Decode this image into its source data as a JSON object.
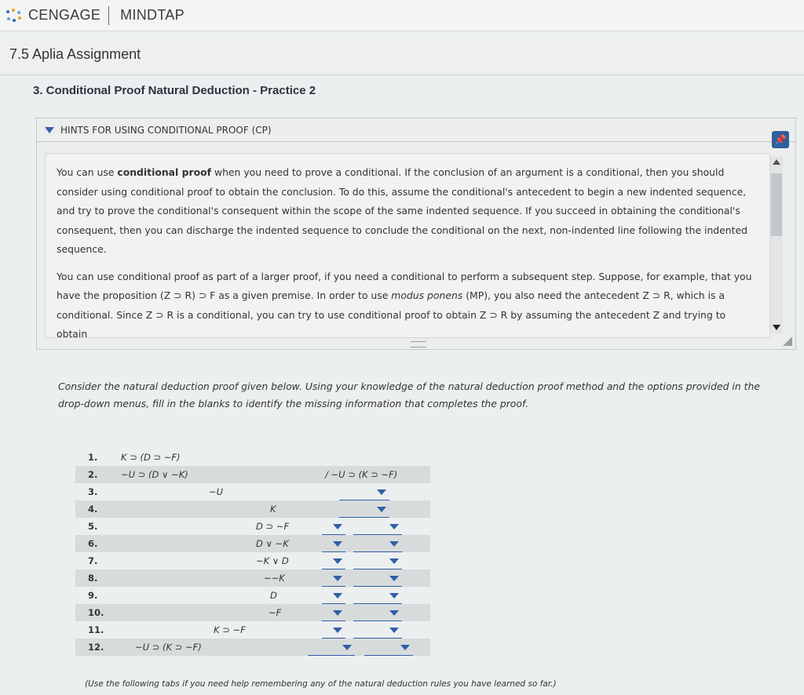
{
  "brand": {
    "name": "CENGAGE",
    "product": "MINDTAP",
    "dot_colors": [
      "#2f6db5",
      "#f0a21e",
      "#5aa9d6"
    ]
  },
  "assignment": {
    "title": "7.5 Aplia Assignment"
  },
  "question": {
    "title": "3. Conditional Proof Natural Deduction - Practice 2"
  },
  "hints": {
    "header": "HINTS FOR USING CONDITIONAL PROOF (CP)",
    "p1_a": "You can use ",
    "p1_bold": "conditional proof",
    "p1_b": " when you need to prove a conditional. If the conclusion of an argument is a conditional, then you should consider using conditional proof to obtain the conclusion. To do this, assume the conditional's antecedent to begin a new indented sequence, and try to prove the conditional's consequent within the scope of the same indented sequence. If you succeed in obtaining the conditional's consequent, then you can discharge the indented sequence to conclude the conditional on the next, non-indented line following the indented sequence.",
    "p2_a": "You can use conditional proof as part of a larger proof, if you need a conditional to perform a subsequent step. Suppose, for example, that you have the proposition (Z ⊃ R) ⊃ F as a given premise. In order to use ",
    "p2_italic": "modus ponens",
    "p2_b": " (MP), you also need the antecedent Z ⊃ R, which is a conditional. Since Z ⊃ R is a conditional, you can try to use conditional proof to obtain Z ⊃ R by assuming the antecedent Z and trying to obtain"
  },
  "instructions": "Consider the natural deduction proof given below. Using your knowledge of the natural deduction proof method and the options provided in the drop-down menus, fill in the blanks to identify the missing information that completes the proof.",
  "proof": {
    "conclusion": "/ ~U ⊃ (K ⊃ ~F)",
    "lines": [
      {
        "num": "1.",
        "formula": "K ⊃ (D ⊃ ~F)"
      },
      {
        "num": "2.",
        "formula": "~U ⊃ (D ∨ ~K)"
      },
      {
        "num": "3.",
        "formula": "~U"
      },
      {
        "num": "4.",
        "formula": "K"
      },
      {
        "num": "5.",
        "formula": "D ⊃ ~F"
      },
      {
        "num": "6.",
        "formula": "D ∨ ~K"
      },
      {
        "num": "7.",
        "formula": "~K ∨ D"
      },
      {
        "num": "8.",
        "formula": "~~K"
      },
      {
        "num": "9.",
        "formula": "D"
      },
      {
        "num": "10.",
        "formula": "~F"
      },
      {
        "num": "11.",
        "formula": "K ⊃ ~F"
      },
      {
        "num": "12.",
        "formula": "~U ⊃ (K ⊃ ~F)"
      }
    ]
  },
  "footnote": "(Use the following tabs if you need help remembering any of the natural deduction rules you have learned so far.)"
}
